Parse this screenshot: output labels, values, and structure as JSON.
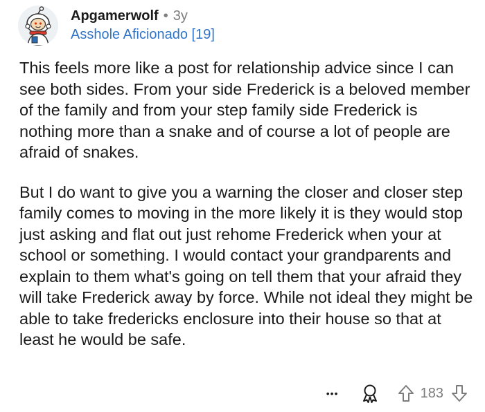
{
  "comment": {
    "author": "Apgamerwolf",
    "separator": "•",
    "age": "3y",
    "flair": "Asshole Aficionado [19]",
    "paragraphs": [
      "This feels more like a post for relationship advice since I can see both sides. From your side Frederick is a beloved member of the family and from your step family side Frederick is nothing more than a snake and of course a lot of people are afraid of snakes.",
      "But I do want to give you a warning the closer and closer step family comes to moving in the more likely it is they would stop just asking and flat out just rehome Frederick when your at school or something. I would contact your grandparents and explain to them what's going on tell them that your afraid they will take Frederick away by force. While not ideal they might be able to take fredericks enclosure into their house so that at least he would be safe."
    ],
    "more_label": "•••",
    "score": "183"
  },
  "icons": {
    "avatar": "snoo-avatar-icon",
    "award": "award-icon",
    "upvote": "upvote-arrow-icon",
    "downvote": "downvote-arrow-icon"
  },
  "colors": {
    "flair": "#2f74c9",
    "meta_gray": "#7c7c7c",
    "text": "#1a1a1b"
  }
}
